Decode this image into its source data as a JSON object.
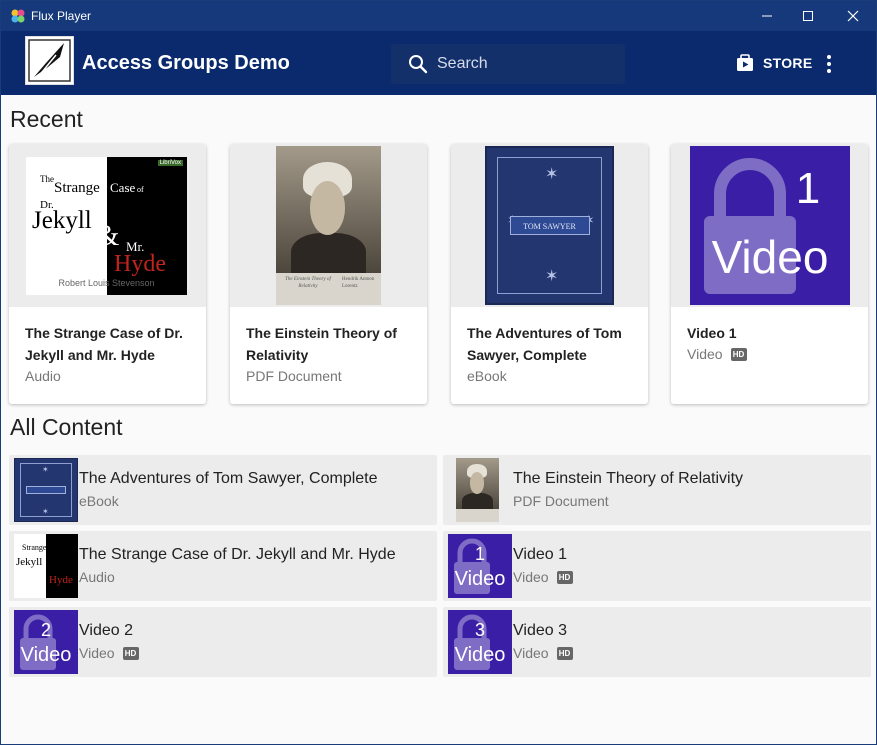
{
  "window": {
    "title": "Flux Player"
  },
  "header": {
    "app_title": "Access Groups Demo",
    "search_placeholder": "Search",
    "store_label": "STORE"
  },
  "sections": {
    "recent": "Recent",
    "all_content": "All Content"
  },
  "recent": [
    {
      "title": "The Strange Case of Dr. Jekyll and Mr. Hyde",
      "type": "Audio",
      "hd": false,
      "thumb": "jekyll"
    },
    {
      "title": "The Einstein Theory of Relativity",
      "type": "PDF Document",
      "hd": false,
      "thumb": "einstein"
    },
    {
      "title": "The Adventures of Tom Sawyer, Complete",
      "type": "eBook",
      "hd": false,
      "thumb": "tom"
    },
    {
      "title": "Video 1",
      "type": "Video",
      "hd": true,
      "thumb": "video",
      "number": "1"
    }
  ],
  "all_content": [
    {
      "title": "The Adventures of Tom Sawyer, Complete",
      "type": "eBook",
      "hd": false
    },
    {
      "title": "The Einstein Theory of Relativity",
      "type": "PDF Document",
      "hd": false
    },
    {
      "title": "The Strange Case of Dr. Jekyll and Mr. Hyde",
      "type": "Audio",
      "hd": false
    },
    {
      "title": "Video 1",
      "type": "Video",
      "hd": true,
      "number": "1"
    },
    {
      "title": "Video 2",
      "type": "Video",
      "hd": true,
      "number": "2"
    },
    {
      "title": "Video 3",
      "type": "Video",
      "hd": true,
      "number": "3"
    }
  ],
  "badges": {
    "hd": "HD"
  },
  "thumb_text": {
    "video_word": "Video",
    "jekyll": {
      "the": "The",
      "strange": "Strange",
      "case": "Case",
      "of": "of",
      "dr": "Dr.",
      "jekyll": "Jekyll",
      "amp": "&",
      "mr": "Mr.",
      "hyde": "Hyde",
      "author": "Robert Louis Stevenson",
      "publisher": "LibriVox"
    },
    "tom": "TOM SAWYER",
    "einstein": {
      "left": "The Einstein Theory of Relativity",
      "right": "Hendrik Antoon Lorentz"
    }
  }
}
